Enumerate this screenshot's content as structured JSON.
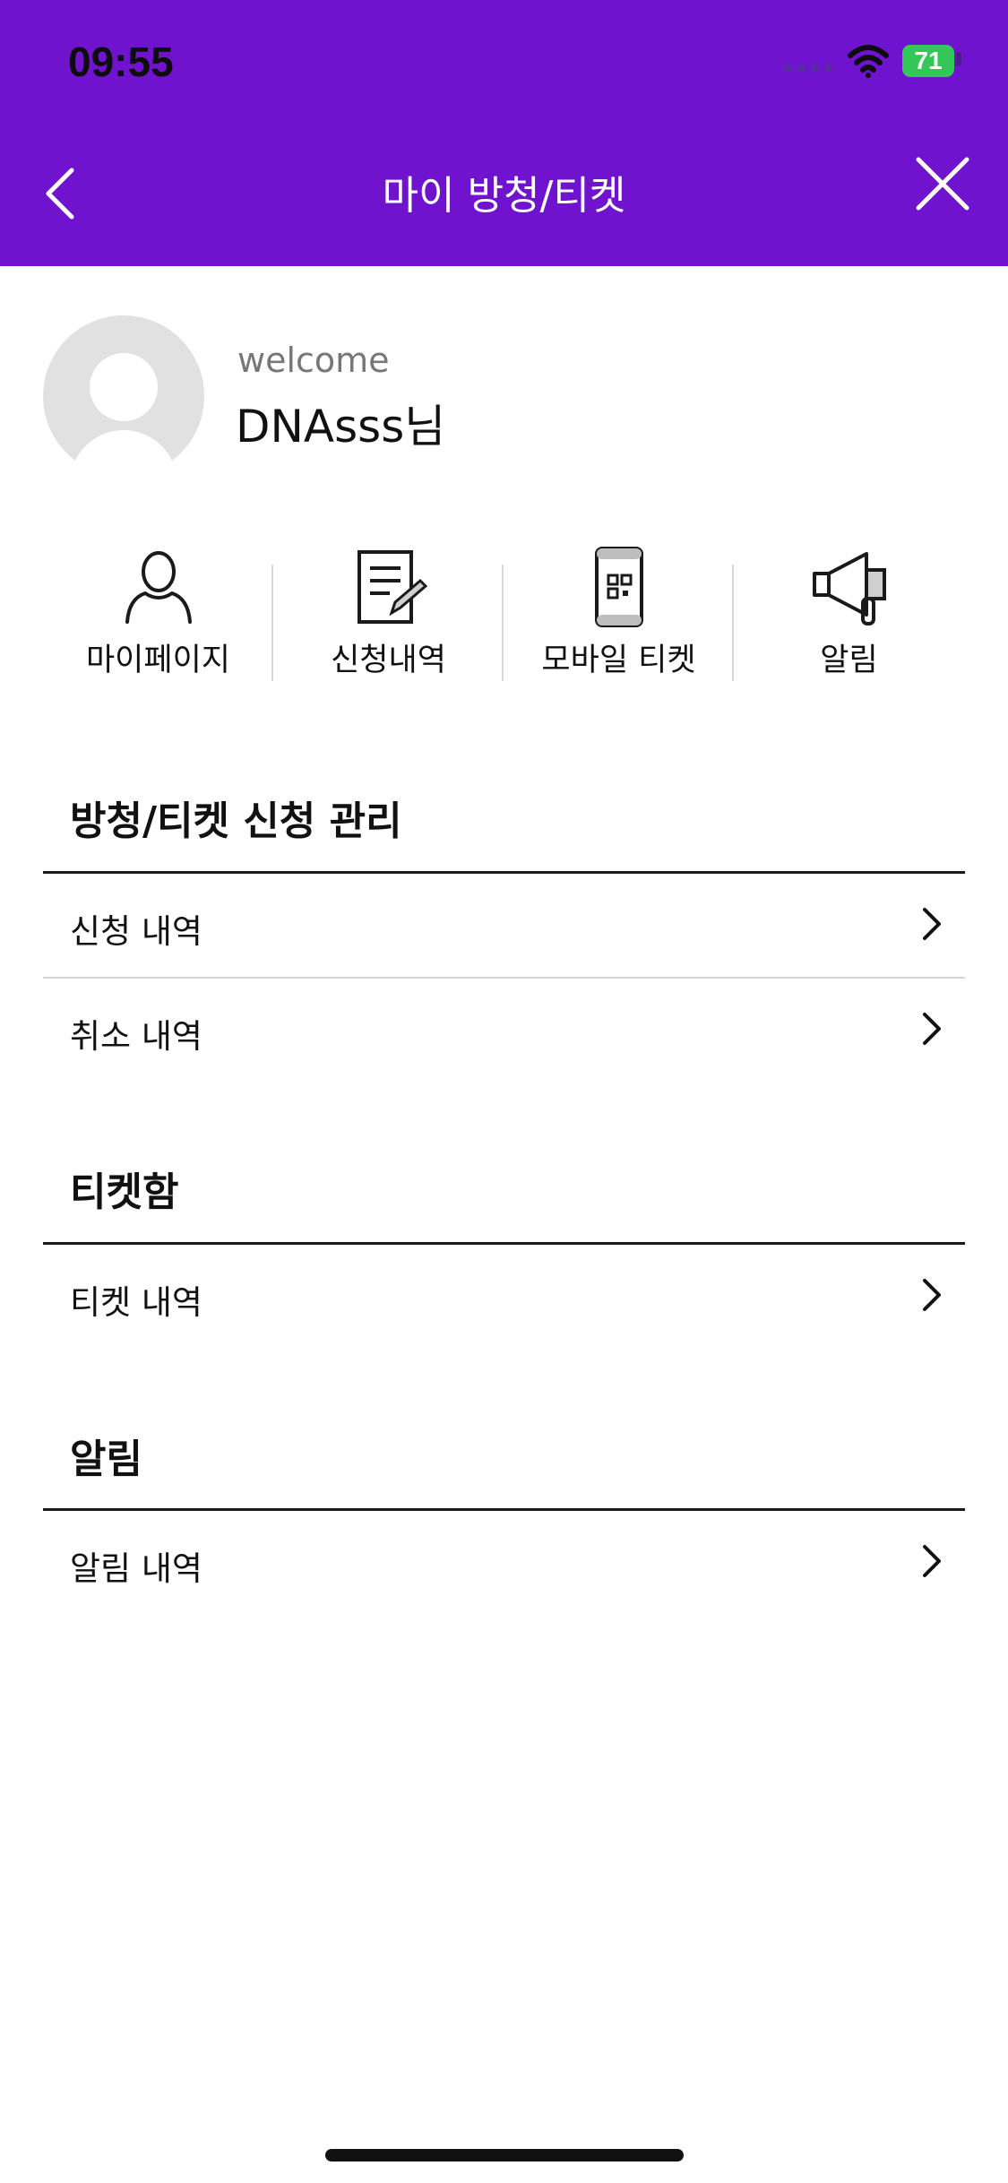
{
  "status_bar": {
    "time": "09:55",
    "battery": "71"
  },
  "header": {
    "title": "마이 방청/티켓"
  },
  "profile": {
    "greeting": "welcome",
    "name": "DNAsss님"
  },
  "quick_menu": [
    {
      "label": "마이페이지",
      "icon": "person-icon"
    },
    {
      "label": "신청내역",
      "icon": "document-pen-icon"
    },
    {
      "label": "모바일 티켓",
      "icon": "mobile-ticket-icon"
    },
    {
      "label": "알림",
      "icon": "megaphone-icon"
    }
  ],
  "sections": [
    {
      "title": "방청/티켓 신청 관리",
      "items": [
        "신청 내역",
        "취소 내역"
      ]
    },
    {
      "title": "티켓함",
      "items": [
        "티켓 내역"
      ]
    },
    {
      "title": "알림",
      "items": [
        "알림 내역"
      ]
    }
  ],
  "colors": {
    "header_bg": "#7013cf",
    "battery": "#33c759"
  }
}
